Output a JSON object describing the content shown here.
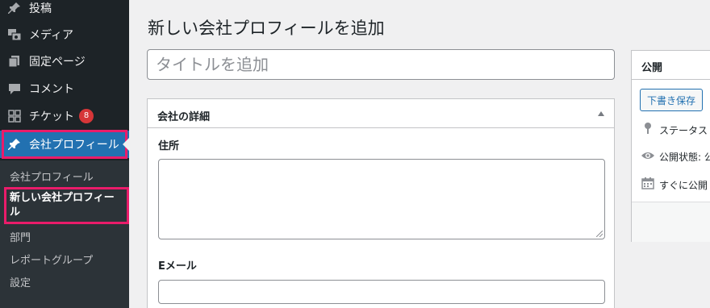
{
  "sidebar": {
    "items": [
      {
        "label": "投稿",
        "icon": "pushpin-icon"
      },
      {
        "label": "メディア",
        "icon": "media-icon"
      },
      {
        "label": "固定ページ",
        "icon": "pages-icon"
      },
      {
        "label": "コメント",
        "icon": "comment-icon"
      },
      {
        "label": "チケット",
        "icon": "grid-icon",
        "badge": "8"
      },
      {
        "label": "会社プロフィール",
        "icon": "pushpin-icon"
      }
    ],
    "submenu": [
      {
        "label": "会社プロフィール"
      },
      {
        "label": "新しい会社プロフィール"
      },
      {
        "label": "部門"
      },
      {
        "label": "レポートグループ"
      },
      {
        "label": "設定"
      }
    ]
  },
  "main": {
    "page_title": "新しい会社プロフィールを追加",
    "title_placeholder": "タイトルを追加",
    "details_box": {
      "title": "会社の詳細",
      "address_label": "住所",
      "email_label": "Eメール"
    }
  },
  "publish_box": {
    "title": "公開",
    "save_draft": "下書き保存",
    "status": "ステータス",
    "visibility": "公開状態: 公",
    "schedule": "すぐに公開"
  },
  "colors": {
    "sidebar_bg": "#1d2327",
    "submenu_bg": "#2c3338",
    "active_bg": "#2271b1",
    "highlight_outline": "#ea1c6a",
    "badge_bg": "#d63638"
  }
}
